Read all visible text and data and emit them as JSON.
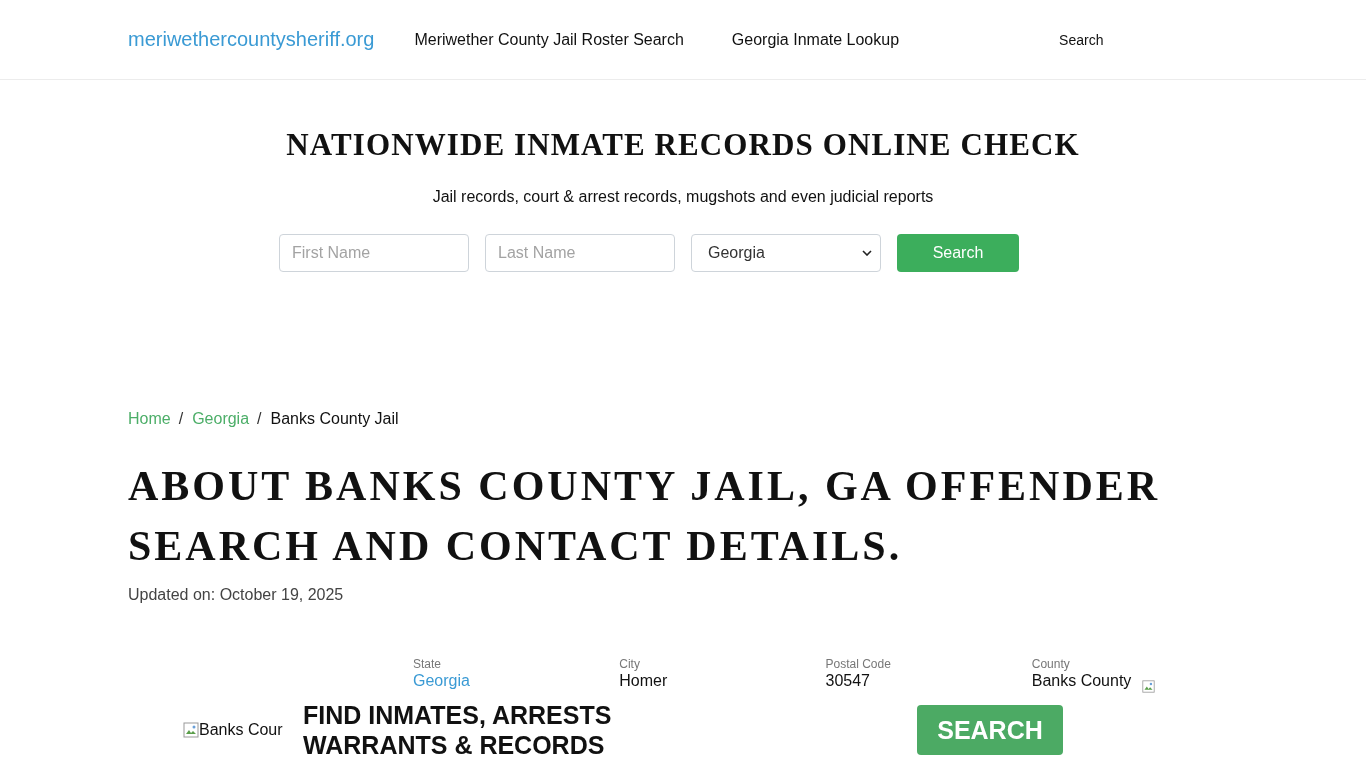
{
  "header": {
    "logo": "meriwethercountysheriff.org",
    "nav": [
      "Meriwether County Jail Roster Search",
      "Georgia Inmate Lookup"
    ],
    "search_link": "Search"
  },
  "hero": {
    "title": "NATIONWIDE INMATE RECORDS ONLINE CHECK",
    "subtitle": "Jail records, court & arrest records, mugshots and even judicial reports",
    "first_name": {
      "placeholder": "First Name"
    },
    "last_name": {
      "placeholder": "Last Name"
    },
    "state_select": {
      "value": "Georgia"
    },
    "search_button": "Search"
  },
  "breadcrumb": {
    "separator": "/",
    "items": [
      {
        "label": "Home",
        "kind": "link"
      },
      {
        "label": "Georgia",
        "kind": "link"
      },
      {
        "label": "Banks County Jail",
        "kind": "current"
      }
    ]
  },
  "page": {
    "title": "ABOUT BANKS COUNTY JAIL, GA OFFENDER SEARCH AND CONTACT DETAILS.",
    "updated": "Updated on: October 19, 2025"
  },
  "facts": [
    {
      "label": "State",
      "value": "Georgia",
      "kind": "link"
    },
    {
      "label": "City",
      "value": "Homer",
      "kind": "text"
    },
    {
      "label": "Postal Code",
      "value": "30547",
      "kind": "text"
    },
    {
      "label": "County",
      "value": "Banks County",
      "kind": "text"
    }
  ],
  "banner": {
    "image_alt": "Banks Cour",
    "headline": "FIND INMATES, ARRESTS WARRANTS & RECORDS",
    "button": "SEARCH"
  }
}
